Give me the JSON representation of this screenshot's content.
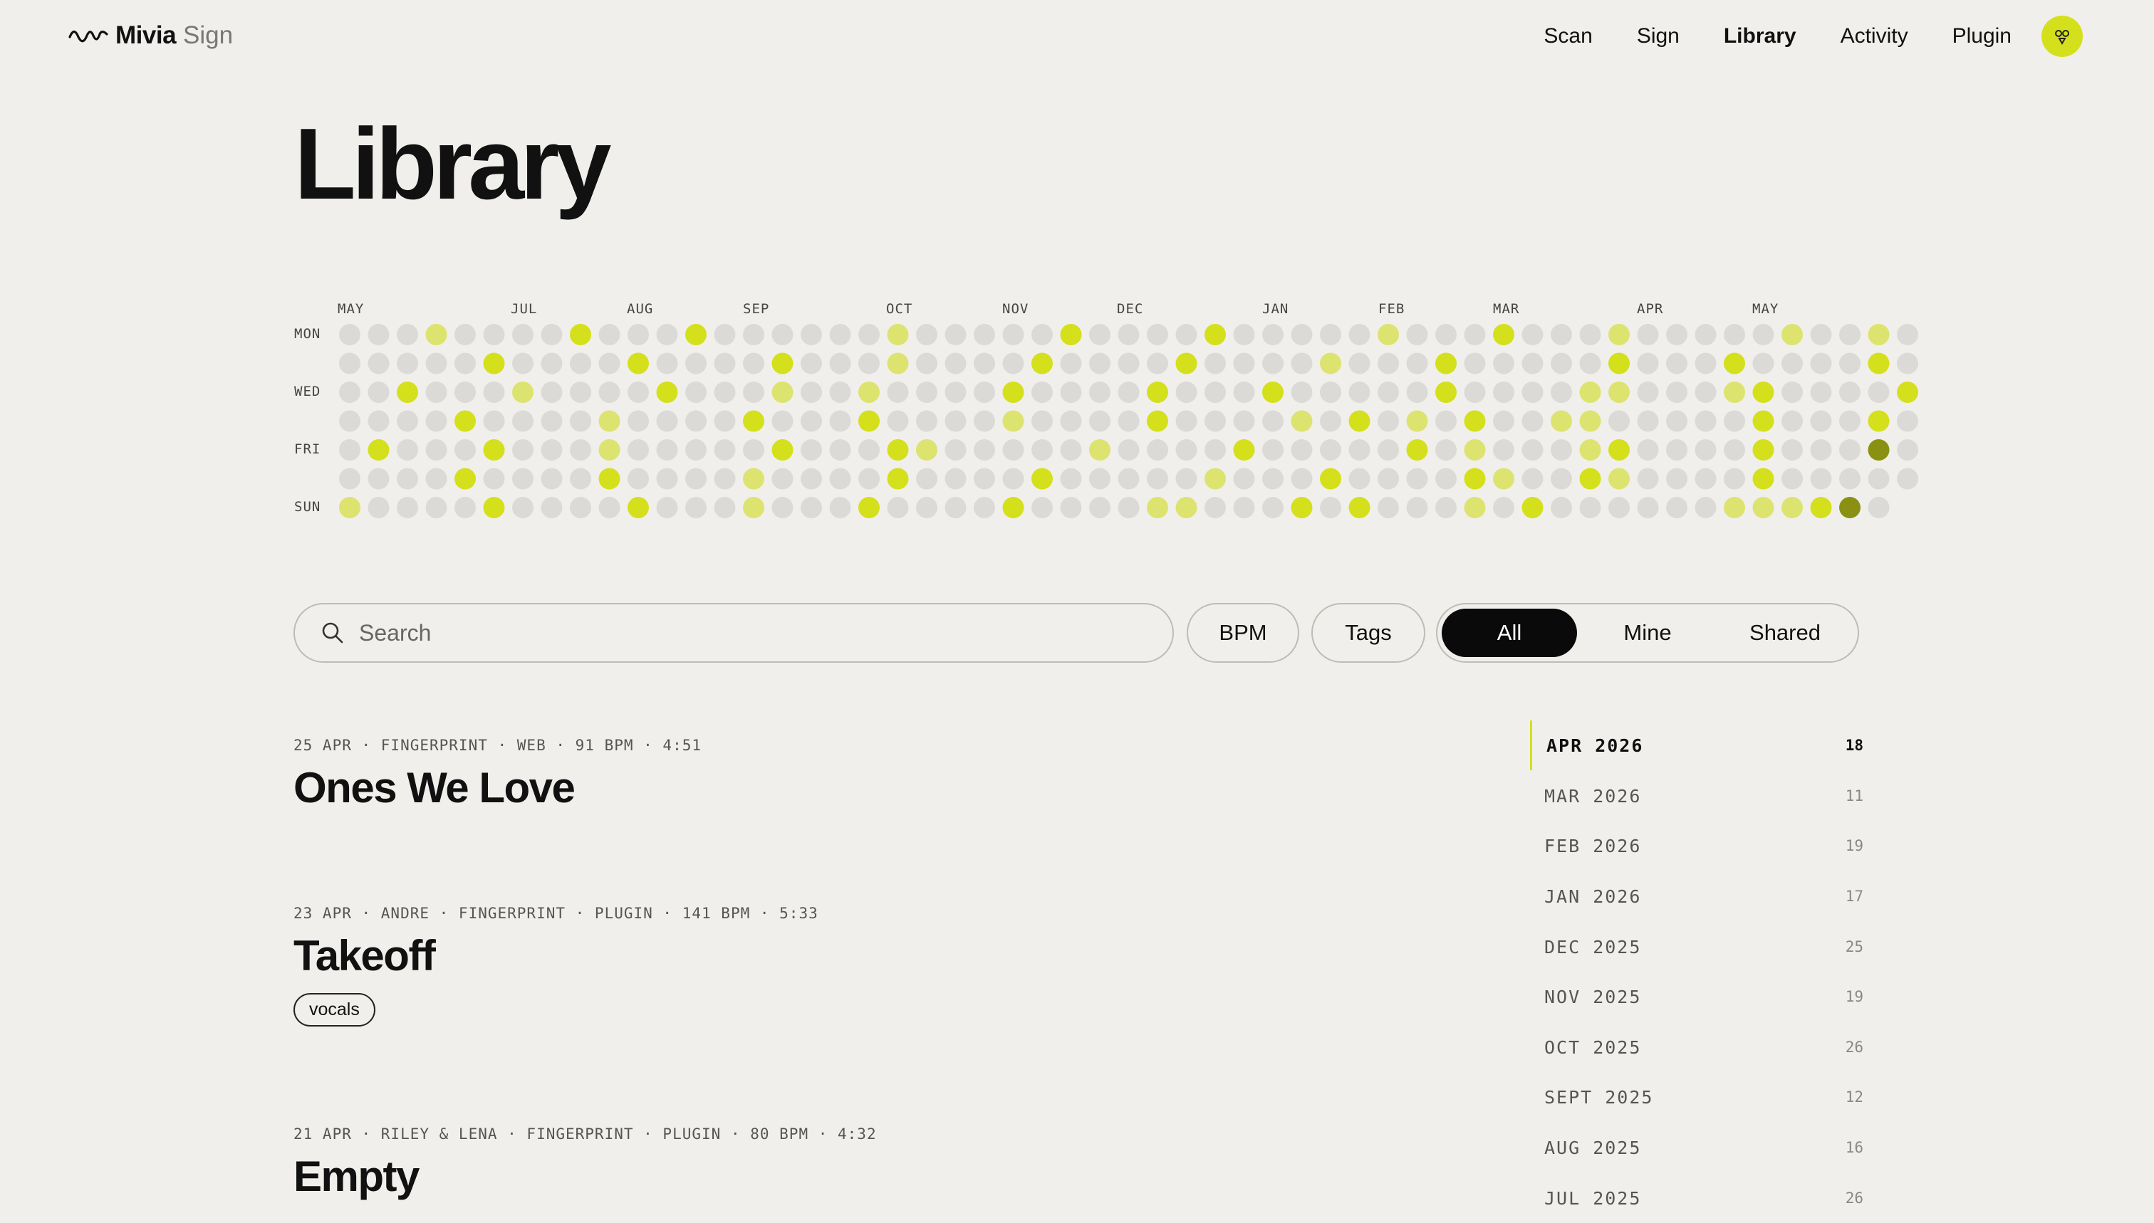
{
  "brand": {
    "name_bold": "Mivia",
    "name_light": "Sign"
  },
  "nav": {
    "items": [
      "Scan",
      "Sign",
      "Library",
      "Activity",
      "Plugin"
    ],
    "active": "Library"
  },
  "page_title": "Library",
  "heatmap": {
    "month_labels": [
      "MAY",
      "JUL",
      "AUG",
      "SEP",
      "OCT",
      "NOV",
      "DEC",
      "JAN",
      "FEB",
      "MAR",
      "APR",
      "MAY"
    ],
    "day_labels": [
      "MON",
      "WED",
      "FRI",
      "SUN"
    ],
    "colors": {
      "empty": "#dbdad6",
      "low": "#dde36f",
      "mid": "#d4e01b",
      "high": "#8a9112"
    },
    "levels_by_day": [
      "0001000020002000000100000200002000001000200010000010010",
      "0000020000200002000100002000020000100020000020002000020",
      "0020001000020001001000020000200020000020000110001200002",
      "0000200001000020002000010000200001020102001100000200020",
      "0200020001000002000210000010000200000201000120000200030",
      "0000200002000010000200002000001000200002100210000200000",
      "100002000020001000200002000011000202000102000000111230"
    ]
  },
  "search": {
    "placeholder": "Search"
  },
  "filters": {
    "bpm": "BPM",
    "tags": "Tags"
  },
  "segmented": {
    "options": [
      "All",
      "Mine",
      "Shared"
    ],
    "active": "All"
  },
  "tracks": [
    {
      "meta": "25 APR · FINGERPRINT · WEB · 91 BPM · 4:51",
      "title": "Ones We Love",
      "tags": []
    },
    {
      "meta": "23 APR · ANDRE · FINGERPRINT · PLUGIN · 141 BPM · 5:33",
      "title": "Takeoff",
      "tags": [
        "vocals"
      ]
    },
    {
      "meta": "21 APR · RILEY & LENA · FINGERPRINT · PLUGIN · 80 BPM · 4:32",
      "title": "Empty",
      "tags": []
    }
  ],
  "months_sidebar": [
    {
      "label": "APR 2026",
      "count": "18",
      "active": true
    },
    {
      "label": "MAR 2026",
      "count": "11"
    },
    {
      "label": "FEB 2026",
      "count": "19"
    },
    {
      "label": "JAN 2026",
      "count": "17"
    },
    {
      "label": "DEC 2025",
      "count": "25"
    },
    {
      "label": "NOV 2025",
      "count": "19"
    },
    {
      "label": "OCT 2025",
      "count": "26"
    },
    {
      "label": "SEPT 2025",
      "count": "12"
    },
    {
      "label": "AUG 2025",
      "count": "16"
    },
    {
      "label": "JUL 2025",
      "count": "26"
    }
  ]
}
